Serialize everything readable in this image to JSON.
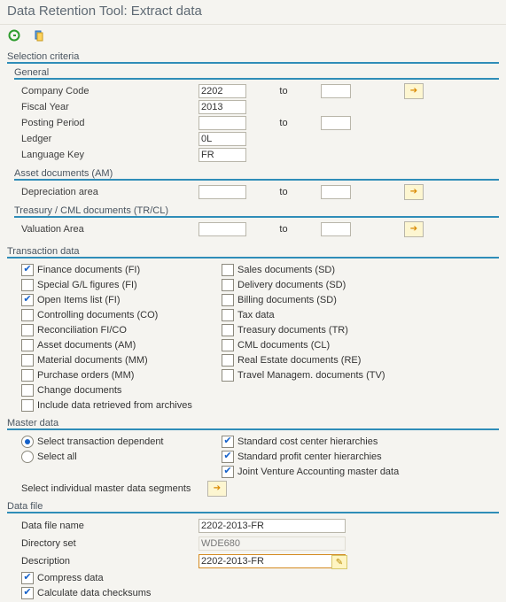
{
  "title": "Data Retention Tool: Extract data",
  "selectionCriteria": {
    "label": "Selection criteria",
    "general": {
      "label": "General",
      "companyCode": {
        "label": "Company Code",
        "from": "2202",
        "to": ""
      },
      "fiscalYear": {
        "label": "Fiscal Year",
        "value": "2013"
      },
      "postingPeriod": {
        "label": "Posting Period",
        "from": "",
        "to": ""
      },
      "ledger": {
        "label": "Ledger",
        "value": "0L"
      },
      "languageKey": {
        "label": "Language Key",
        "value": "FR"
      }
    },
    "assetDocs": {
      "label": "Asset documents (AM)",
      "depreciationArea": {
        "label": "Depreciation area",
        "from": "",
        "to": ""
      }
    },
    "treasury": {
      "label": "Treasury / CML documents (TR/CL)",
      "valuationArea": {
        "label": "Valuation Area",
        "from": "",
        "to": ""
      }
    }
  },
  "txn": {
    "label": "Transaction data",
    "left": [
      {
        "label": "Finance documents (FI)",
        "checked": true
      },
      {
        "label": "Special G/L figures (FI)",
        "checked": false
      },
      {
        "label": "Open Items list (FI)",
        "checked": true
      },
      {
        "label": "Controlling documents (CO)",
        "checked": false
      },
      {
        "label": "Reconciliation FI/CO",
        "checked": false
      },
      {
        "label": "Asset documents (AM)",
        "checked": false
      },
      {
        "label": "Material documents (MM)",
        "checked": false
      },
      {
        "label": "Purchase orders (MM)",
        "checked": false
      },
      {
        "label": "Change documents",
        "checked": false
      },
      {
        "label": "Include data retrieved from archives",
        "checked": false
      }
    ],
    "right": [
      {
        "label": "Sales documents (SD)",
        "checked": false
      },
      {
        "label": "Delivery documents (SD)",
        "checked": false
      },
      {
        "label": "Billing documents (SD)",
        "checked": false
      },
      {
        "label": "Tax data",
        "checked": false
      },
      {
        "label": "Treasury documents (TR)",
        "checked": false
      },
      {
        "label": "CML documents (CL)",
        "checked": false
      },
      {
        "label": "Real Estate documents (RE)",
        "checked": false
      },
      {
        "label": "Travel Managem. documents (TV)",
        "checked": false
      }
    ]
  },
  "master": {
    "label": "Master data",
    "radio1": "Select transaction dependent",
    "radio2": "Select all",
    "radioSel": 1,
    "opts": [
      {
        "label": "Standard cost center hierarchies",
        "checked": true
      },
      {
        "label": "Standard profit center hierarchies",
        "checked": true
      },
      {
        "label": "Joint Venture Accounting master data",
        "checked": true
      }
    ],
    "segLabel": "Select individual master data segments"
  },
  "dataFile": {
    "label": "Data file",
    "fileName": {
      "label": "Data file name",
      "value": "2202-2013-FR"
    },
    "dirSet": {
      "label": "Directory set",
      "value": "WDE680"
    },
    "desc": {
      "label": "Description",
      "value": "2202-2013-FR"
    },
    "compress": {
      "label": "Compress data",
      "checked": true
    },
    "checksums": {
      "label": "Calculate data checksums",
      "checked": true
    }
  },
  "txt": {
    "to": "to"
  }
}
